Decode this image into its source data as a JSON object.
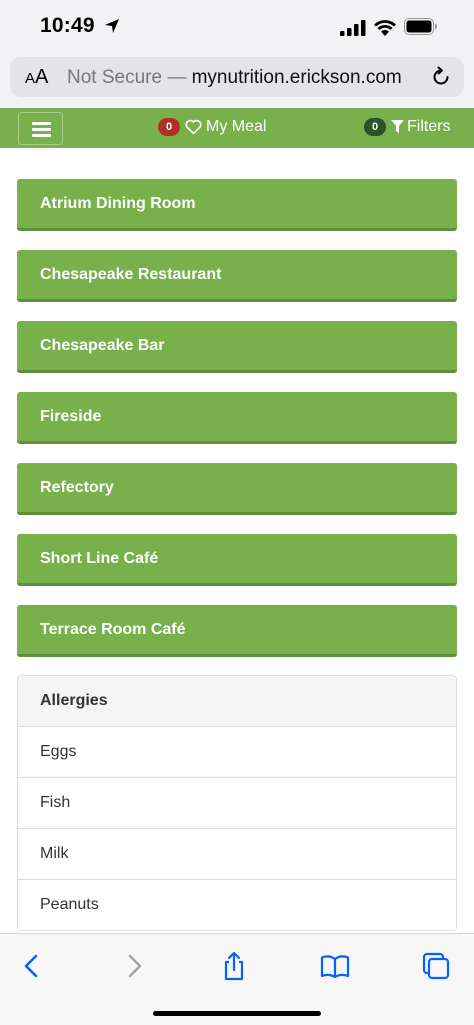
{
  "status_bar": {
    "time": "10:49"
  },
  "browser": {
    "aa_small": "A",
    "aa_large": "A",
    "url_prefix": "Not Secure —",
    "url_domain": "mynutrition.erickson.com"
  },
  "nav": {
    "my_meal_count": "0",
    "my_meal_label": "My Meal",
    "filters_count": "0",
    "filters_label": "Filters"
  },
  "venues": [
    {
      "label": "Atrium Dining Room"
    },
    {
      "label": "Chesapeake Restaurant"
    },
    {
      "label": "Chesapeake Bar"
    },
    {
      "label": "Fireside"
    },
    {
      "label": "Refectory"
    },
    {
      "label": "Short Line Café"
    },
    {
      "label": "Terrace Room Café"
    }
  ],
  "allergies": {
    "title": "Allergies",
    "items": [
      "Eggs",
      "Fish",
      "Milk",
      "Peanuts"
    ]
  },
  "colors": {
    "brand_green": "#78b04c",
    "badge_red": "#b03025",
    "badge_dark": "#2c5228",
    "safari_blue": "#0a60ff"
  },
  "icons": {
    "location": "location-arrow-icon",
    "signal": "signal-bars-icon",
    "wifi": "wifi-icon",
    "battery": "battery-icon",
    "reload": "reload-icon",
    "menu": "hamburger-menu-icon",
    "heart": "heart-icon",
    "filter": "filter-funnel-icon",
    "back": "back-chevron-icon",
    "forward": "forward-chevron-icon",
    "share": "share-icon",
    "bookmarks": "bookmarks-book-icon",
    "tabs": "tabs-icon"
  }
}
